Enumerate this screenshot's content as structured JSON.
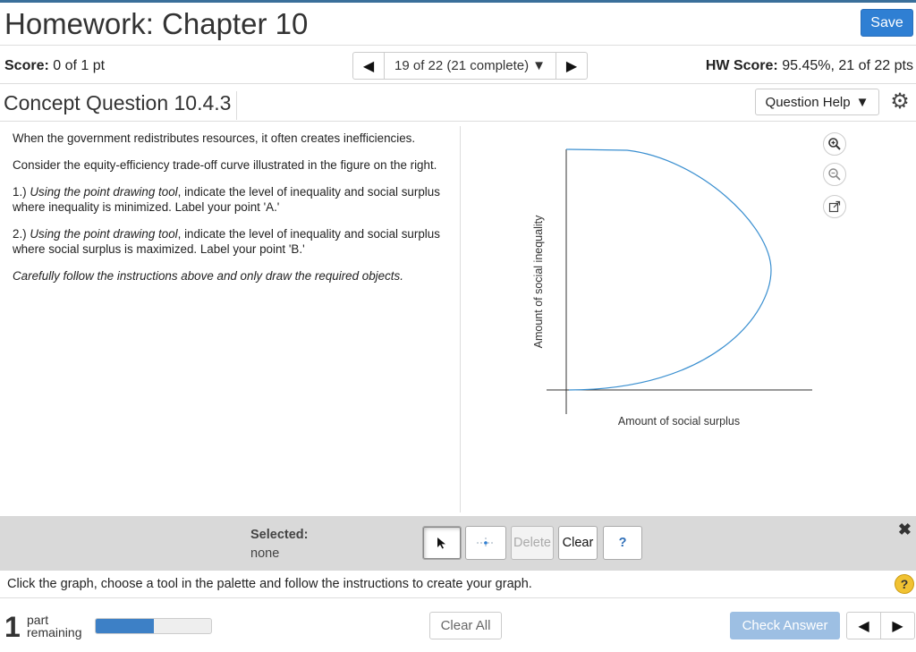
{
  "header": {
    "title": "Homework: Chapter 10",
    "save_label": "Save"
  },
  "scorebar": {
    "score_label": "Score:",
    "score_value": "0 of 1 pt",
    "question_position": "19 of 22 (21 complete)",
    "hw_score_label": "HW Score:",
    "hw_score_value": "95.45%, 21 of 22 pts"
  },
  "question": {
    "title": "Concept Question 10.4.3",
    "help_label": "Question Help",
    "paragraphs": {
      "p1": "When the government redistributes resources, it often creates inefficiencies.",
      "p2": "Consider the equity-efficiency trade-off curve illustrated in the figure on the right.",
      "p3_prefix": "1.) ",
      "p3_italic": "Using the point drawing tool",
      "p3_rest": ", indicate the level of inequality and social surplus where inequality is minimized. Label your point 'A.'",
      "p4_prefix": "2.) ",
      "p4_italic": "Using the point drawing tool",
      "p4_rest": ", indicate the level of inequality and social surplus where social surplus is maximized. Label your point 'B.'",
      "p5": "Carefully follow the instructions above and only draw the required objects."
    }
  },
  "graph": {
    "xlabel": "Amount of social surplus",
    "ylabel": "Amount of social inequality",
    "curve_color": "#3a8fd0",
    "icons": [
      "zoom-in-icon",
      "zoom-out-icon",
      "popout-icon"
    ]
  },
  "palette": {
    "selected_label": "Selected:",
    "selected_value": "none",
    "delete_label": "Delete",
    "clear_label": "Clear",
    "help_label": "?"
  },
  "instructions": {
    "text": "Click the graph, choose a tool in the palette and follow the instructions to create your graph."
  },
  "footer": {
    "parts_number": "1",
    "parts_label_line1": "part",
    "parts_label_line2": "remaining",
    "progress_fraction": 0.5,
    "clear_all_label": "Clear All",
    "check_answer_label": "Check Answer"
  },
  "colors": {
    "accent": "#2f7fd3",
    "check_disabled": "#9dbfe3"
  }
}
